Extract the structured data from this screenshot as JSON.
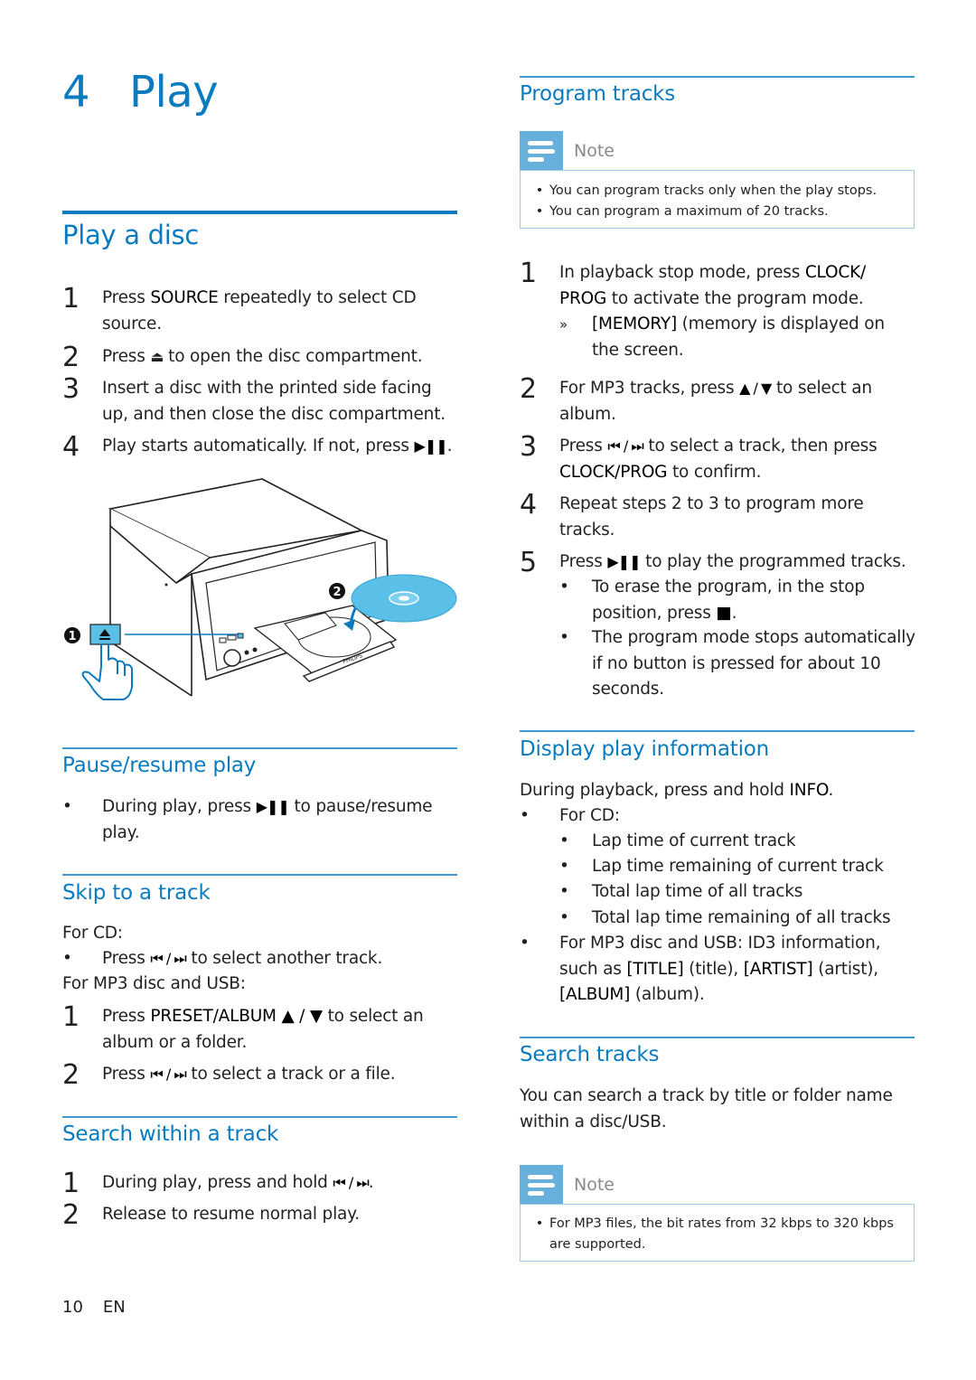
{
  "chapter": {
    "number": "4",
    "title": "Play"
  },
  "play_disc": {
    "title": "Play a disc",
    "steps": [
      {
        "n": "1",
        "pre": "Press ",
        "key": "SOURCE",
        "post": " repeatedly to select CD source."
      },
      {
        "n": "2",
        "pre": "Press ",
        "icon": "⏏",
        "post": " to open the disc compartment."
      },
      {
        "n": "3",
        "text": "Insert a disc with the printed side facing up, and then close the disc compartment."
      },
      {
        "n": "4",
        "pre": "Play starts automatically. If not, press ",
        "icon": "▶❚❚",
        "post": "."
      }
    ],
    "illustration": {
      "callout1": "1",
      "callout2": "2",
      "brand": "PHILIPS",
      "eject_icon": "eject-icon",
      "accent": "#5bc0e8"
    }
  },
  "pause_resume": {
    "title": "Pause/resume play",
    "items": [
      {
        "pre": "During play, press ",
        "icon": "▶❚❚",
        "post": " to pause/resume play."
      }
    ]
  },
  "skip_track": {
    "title": "Skip to a track",
    "for_cd": "For CD:",
    "cd_items": [
      {
        "pre": "Press ",
        "icon": "⏮ / ⏭",
        "post": " to select another track."
      }
    ],
    "for_mp3": "For MP3 disc and USB:",
    "steps": [
      {
        "n": "1",
        "pre": "Press ",
        "key": "PRESET/ALBUM ▲ / ▼",
        "post": " to select an album or a folder."
      },
      {
        "n": "2",
        "pre": "Press ",
        "icon": "⏮ / ⏭",
        "post": " to select a track or a file."
      }
    ]
  },
  "search_within": {
    "title": "Search within a track",
    "steps": [
      {
        "n": "1",
        "pre": "During play, press and hold ",
        "icon": "⏮ / ⏭",
        "post": "."
      },
      {
        "n": "2",
        "text": "Release to resume normal play."
      }
    ]
  },
  "program_tracks": {
    "title": "Program tracks",
    "note_label": "Note",
    "note_items": [
      "You can program tracks only when the play stops.",
      "You can program a maximum of 20 tracks."
    ],
    "steps": [
      {
        "n": "1",
        "pre": "In playback stop mode, press ",
        "key": "CLOCK/ PROG",
        "post": " to activate the program mode."
      },
      {
        "n": "2",
        "pre": "For MP3 tracks, press ",
        "icon": "▲ / ▼",
        "post": " to select an album."
      },
      {
        "n": "3",
        "pre": "Press ",
        "icon": "⏮ / ⏭",
        "post": " to select a track, then press ",
        "key2": "CLOCK/PROG",
        "post2": " to confirm."
      },
      {
        "n": "4",
        "text": "Repeat steps 2 to 3 to program more tracks."
      },
      {
        "n": "5",
        "pre": "Press ",
        "icon": "▶❚❚",
        "post": " to play the programmed tracks."
      }
    ],
    "result_marker": "»",
    "result": {
      "key": "[MEMORY]",
      "post": " (memory is displayed on the screen."
    },
    "step5_bullets": [
      {
        "pre": "To erase the program, in the stop position, press ",
        "icon": "■",
        "post": "."
      },
      {
        "text": "The program mode stops automatically if no button is pressed for about 10 seconds."
      }
    ]
  },
  "display_info": {
    "title": "Display play information",
    "intro_pre": "During playback, press and hold ",
    "intro_key": "INFO",
    "intro_post": ".",
    "for_cd": "For CD:",
    "cd_items": [
      "Lap time of current track",
      "Lap time remaining of current track",
      "Total lap time of all tracks",
      "Total lap time remaining of all tracks"
    ],
    "mp3": {
      "pre": "For MP3 disc and USB: ID3 information, such as ",
      "k1": "[TITLE]",
      "m1": " (title), ",
      "k2": "[ARTIST]",
      "m2": " (artist), ",
      "k3": "[ALBUM]",
      "m3": " (album)."
    }
  },
  "search_tracks": {
    "title": "Search tracks",
    "text": "You can search a track by title or folder name within a disc/USB.",
    "note_label": "Note",
    "note_items": [
      "For MP3 files, the bit rates from 32 kbps to 320 kbps are supported."
    ]
  },
  "footer": {
    "page": "10",
    "lang": "EN"
  },
  "bullet": "•"
}
